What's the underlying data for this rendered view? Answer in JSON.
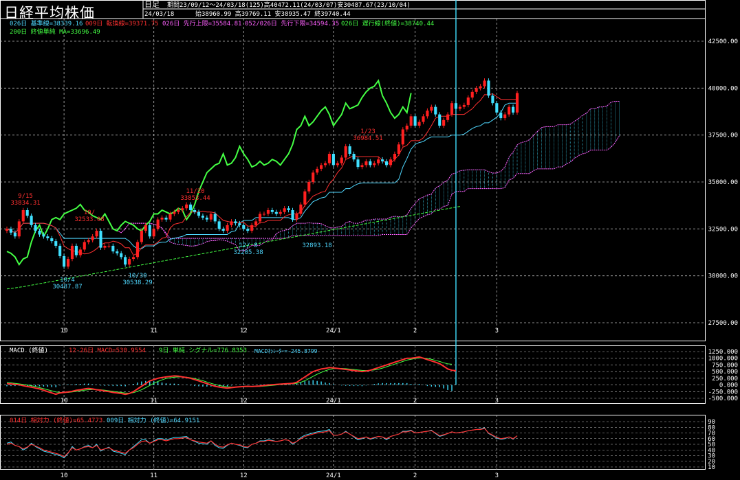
{
  "header": {
    "title": "日経平均株価",
    "period_type": "日足",
    "summary": "期間23/09/12〜24/03/18(125)高40472.11(24/03/07)安30487.67(23/10/04)",
    "date": "24/03/18",
    "ohlc": "始38960.99 高39769.11 安38935.47 終39740.44"
  },
  "legend": {
    "line1": [
      {
        "text": "026日 基準線=38339.16",
        "color": "#4fd8ff"
      },
      {
        "text": "009日 転換線=39371.75",
        "color": "#ff3030"
      },
      {
        "text": "026日 先行上限=35584.81",
        "color": "#ff60ff"
      },
      {
        "text": "052/026日 先行下限=34594.35",
        "color": "#ff60ff"
      },
      {
        "text": "026日 遅行線(終値)=38740.44",
        "color": "#44ff44"
      }
    ],
    "line2": [
      {
        "text": "200日 終値単純 MA=33696.49",
        "color": "#44ff44"
      }
    ]
  },
  "panels": {
    "macd_legend": [
      {
        "text": "MACD (終値)",
        "color": "#ffffff"
      },
      {
        "text": "12-26日 MACD=530.9554",
        "color": "#ff3030"
      },
      {
        "text": "9日 単純 シグナル=776.8353",
        "color": "#44ff44"
      },
      {
        "text": "MACDｵｼﾚｰﾀｰ=-245.8799",
        "color": "#4fd8ff"
      }
    ],
    "rsi_legend": [
      {
        "text": "014日 相対力 (終値)=65.4773",
        "color": "#ff3030"
      },
      {
        "text": "009日 相対力 (終値)=64.9151",
        "color": "#4fd8ff"
      }
    ]
  },
  "annotations": [
    {
      "date": "9/15",
      "value": "33834.31",
      "color": "#ff3030"
    },
    {
      "date": "10/4",
      "value": "30487.87",
      "color": "#4fd8ff"
    },
    {
      "date": "10/",
      "value": "32533.08",
      "color": "#ff3030"
    },
    {
      "date": "10/30",
      "value": "30538.29",
      "color": "#4fd8ff"
    },
    {
      "date": "11/20",
      "value": "33853.44",
      "color": "#ff3030"
    },
    {
      "date": "12/ 8",
      "value": "32205.38",
      "color": "#4fd8ff"
    },
    {
      "date": "",
      "value": "32893.18",
      "color": "#4fd8ff"
    },
    {
      "date": "1/23",
      "value": "36984.51",
      "color": "#ff3030"
    }
  ],
  "chart_data": [
    {
      "type": "candlestick",
      "title": "日経平均株価",
      "ylim": [
        27500,
        42500
      ],
      "yticks": [
        "42500.00",
        "40000.00",
        "37500.00",
        "35000.00",
        "32500.00",
        "30000.00",
        "27500.00"
      ],
      "xticks": [
        "10",
        "11",
        "12",
        "24/1",
        "2",
        "3"
      ],
      "grid": true,
      "colors": {
        "up": "#ff2020",
        "down": "#40e0ff",
        "kijun": "#4fd8ff",
        "tenkan": "#ff3030",
        "chikou": "#44ff44",
        "ma200": "#44ff44",
        "cloud": "#ff60ff",
        "cloud_fill": "#40e0ff"
      },
      "close": [
        32500,
        32300,
        32100,
        32900,
        33500,
        33200,
        32700,
        32400,
        32200,
        32100,
        32000,
        31850,
        31600,
        31050,
        30490,
        30900,
        31600,
        31100,
        31400,
        31800,
        31900,
        32100,
        32400,
        31500,
        31600,
        31600,
        31300,
        31200,
        31000,
        30600,
        30900,
        31000,
        31800,
        32400,
        32700,
        32100,
        32500,
        33000,
        33100,
        33000,
        33300,
        33400,
        33500,
        33600,
        33800,
        33500,
        33400,
        33200,
        33100,
        33000,
        33300,
        32900,
        32500,
        32400,
        32700,
        32900,
        32800,
        32700,
        32500,
        32400,
        32700,
        32900,
        33300,
        33300,
        33500,
        33400,
        33300,
        33400,
        33600,
        33500,
        33000,
        33300,
        33800,
        34500,
        35000,
        35500,
        35700,
        35900,
        36000,
        36500,
        35900,
        36000,
        36300,
        36900,
        36500,
        36200,
        35800,
        35900,
        36100,
        35900,
        36000,
        36200,
        36100,
        35900,
        36200,
        36500,
        37000,
        37800,
        38000,
        38500,
        38000,
        38200,
        38500,
        38800,
        39000,
        38600,
        38000,
        38300,
        38600,
        39200,
        38900,
        39000,
        39100,
        39500,
        39800,
        40000,
        40100,
        40400,
        39600,
        39200,
        38700,
        38400,
        38600,
        39000,
        38700,
        39740
      ],
      "ma200": [
        29300,
        29330,
        29360,
        29390,
        29420,
        29460,
        29500,
        29540,
        29580,
        29620,
        29660,
        29700,
        29740,
        29780,
        29820,
        29860,
        29900,
        29940,
        29980,
        30020,
        30060,
        30100,
        30140,
        30180,
        30220,
        30260,
        30300,
        30340,
        30380,
        30420,
        30460,
        30500,
        30540,
        30580,
        30620,
        30660,
        30700,
        30740,
        30780,
        30820,
        30860,
        30900,
        30940,
        30980,
        31020,
        31060,
        31100,
        31140,
        31180,
        31220,
        31260,
        31300,
        31340,
        31380,
        31420,
        31460,
        31500,
        31540,
        31580,
        31620,
        31660,
        31700,
        31740,
        31780,
        31820,
        31860,
        31900,
        31940,
        31980,
        32020,
        32060,
        32100,
        32140,
        32180,
        32220,
        32260,
        32300,
        32340,
        32380,
        32420,
        32460,
        32500,
        32540,
        32580,
        32620,
        32660,
        32700,
        32740,
        32780,
        32820,
        32860,
        32900,
        32940,
        32980,
        33020,
        33060,
        33100,
        33140,
        33180,
        33220,
        33260,
        33300,
        33340,
        33380,
        33420,
        33460,
        33500,
        33540,
        33580,
        33620,
        33660,
        33696
      ]
    },
    {
      "type": "line",
      "title": "MACD (終値)",
      "ylim": [
        -500,
        1250
      ],
      "yticks": [
        "1250.000",
        "1000.000",
        "750.000",
        "500.000",
        "250.000",
        "0.000",
        "-250.000",
        "-500.000"
      ],
      "series": [
        {
          "name": "12-26日 MACD",
          "values": [
            50,
            40,
            20,
            10,
            -30,
            -60,
            -80,
            -120,
            -150,
            -200,
            -250,
            -300,
            -350,
            -300,
            -280,
            -260,
            -240,
            -200,
            -180,
            -150,
            -130,
            -150,
            -180,
            -200,
            -230,
            -250,
            -280,
            -300,
            -320,
            -350,
            -320,
            -250,
            -150,
            -50,
            50,
            150,
            200,
            250,
            280,
            300,
            320,
            340,
            330,
            300,
            280,
            250,
            200,
            150,
            100,
            50,
            0,
            -50,
            -80,
            -100,
            -120,
            -100,
            -80,
            -70,
            -60,
            -50,
            -60,
            -50,
            -40,
            -20,
            0,
            10,
            20,
            30,
            40,
            50,
            60,
            100,
            200,
            300,
            400,
            500,
            550,
            600,
            620,
            650,
            640,
            620,
            600,
            580,
            560,
            540,
            520,
            500,
            520,
            550,
            600,
            650,
            700,
            750,
            800,
            850,
            900,
            950,
            1000,
            1000,
            1020,
            1050,
            1000,
            950,
            900,
            850,
            800,
            700,
            600,
            550,
            531
          ]
        },
        {
          "name": "9日 単純 シグナル",
          "values": [
            100,
            80,
            60,
            40,
            20,
            0,
            -30,
            -60,
            -100,
            -140,
            -180,
            -220,
            -260,
            -280,
            -290,
            -280,
            -260,
            -240,
            -220,
            -200,
            -180,
            -170,
            -170,
            -180,
            -200,
            -220,
            -240,
            -260,
            -280,
            -300,
            -310,
            -290,
            -240,
            -180,
            -100,
            -20,
            60,
            130,
            190,
            240,
            270,
            290,
            300,
            300,
            290,
            270,
            240,
            200,
            160,
            110,
            60,
            20,
            -20,
            -50,
            -70,
            -80,
            -80,
            -75,
            -70,
            -65,
            -60,
            -58,
            -55,
            -45,
            -30,
            -15,
            0,
            15,
            25,
            35,
            45,
            60,
            100,
            160,
            240,
            320,
            400,
            470,
            530,
            580,
            610,
            620,
            620,
            610,
            595,
            580,
            560,
            545,
            540,
            545,
            560,
            590,
            630,
            680,
            730,
            780,
            830,
            880,
            930,
            960,
            990,
            1010,
            1010,
            990,
            960,
            920,
            880,
            830,
            790,
            777
          ]
        }
      ]
    },
    {
      "type": "line",
      "title": "相対力",
      "ylim": [
        10,
        90
      ],
      "yticks": [
        "90",
        "80",
        "70",
        "60",
        "50",
        "40",
        "30",
        "20",
        "10"
      ],
      "series": [
        {
          "name": "014日 相対力 (終値)",
          "values": [
            50,
            52,
            48,
            46,
            42,
            45,
            50,
            47,
            44,
            40,
            38,
            36,
            34,
            32,
            28,
            35,
            44,
            40,
            42,
            45,
            46,
            44,
            48,
            40,
            42,
            44,
            40,
            38,
            36,
            34,
            40,
            44,
            50,
            55,
            56,
            52,
            55,
            58,
            58,
            56,
            58,
            60,
            60,
            61,
            62,
            58,
            56,
            54,
            53,
            52,
            56,
            50,
            46,
            45,
            49,
            52,
            50,
            49,
            46,
            45,
            50,
            52,
            55,
            55,
            57,
            56,
            55,
            56,
            58,
            57,
            52,
            55,
            60,
            64,
            66,
            68,
            70,
            71,
            72,
            74,
            66,
            66,
            68,
            72,
            68,
            64,
            60,
            61,
            63,
            60,
            62,
            64,
            63,
            60,
            64,
            66,
            68,
            72,
            72,
            74,
            70,
            71,
            72,
            73,
            74,
            70,
            65,
            67,
            69,
            72,
            70,
            71,
            72,
            74,
            75,
            76,
            76,
            78,
            70,
            66,
            62,
            60,
            61,
            63,
            60,
            65
          ]
        },
        {
          "name": "009日 相対力 (終値)",
          "values": [
            52,
            54,
            48,
            46,
            40,
            44,
            52,
            46,
            42,
            38,
            36,
            34,
            32,
            30,
            26,
            34,
            46,
            40,
            42,
            46,
            48,
            44,
            50,
            38,
            42,
            45,
            38,
            36,
            34,
            32,
            40,
            46,
            52,
            58,
            58,
            52,
            56,
            60,
            60,
            58,
            60,
            62,
            62,
            63,
            64,
            58,
            55,
            52,
            51,
            50,
            56,
            48,
            44,
            43,
            48,
            52,
            50,
            48,
            45,
            44,
            50,
            52,
            56,
            56,
            58,
            57,
            55,
            56,
            58,
            57,
            50,
            55,
            62,
            66,
            68,
            70,
            72,
            73,
            74,
            76,
            66,
            66,
            68,
            73,
            68,
            63,
            58,
            60,
            63,
            59,
            61,
            64,
            63,
            58,
            64,
            66,
            68,
            73,
            73,
            75,
            70,
            71,
            72,
            73,
            75,
            69,
            64,
            66,
            69,
            72,
            70,
            71,
            72,
            74,
            75,
            76,
            77,
            79,
            69,
            65,
            61,
            59,
            60,
            63,
            59,
            65
          ]
        }
      ]
    }
  ]
}
